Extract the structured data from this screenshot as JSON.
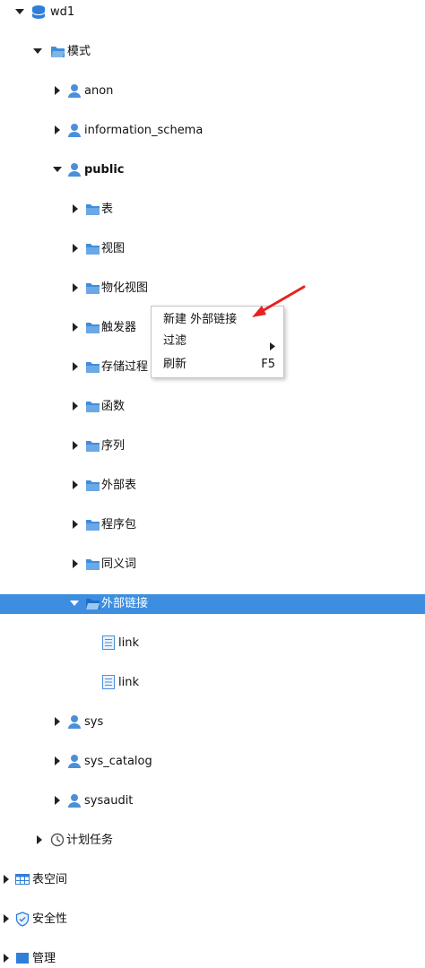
{
  "tree": {
    "db": "wd1",
    "schemas_folder": "模式",
    "schema_anon": "anon",
    "schema_information": "information_schema",
    "schema_public": "public",
    "public_children": [
      "表",
      "视图",
      "物化视图",
      "触发器",
      "存储过程",
      "函数",
      "序列",
      "外部表",
      "程序包",
      "同义词",
      "外部链接"
    ],
    "links": [
      "link",
      "link"
    ],
    "schema_sys": "sys",
    "schema_sys_catalog": "sys_catalog",
    "schema_sysaudit": "sysaudit",
    "scheduled_tasks": "计划任务",
    "tablespaces": "表空间",
    "security": "安全性",
    "cutoff": "管理"
  },
  "context_menu": {
    "new_link": "新建 外部链接",
    "filter": "过滤",
    "refresh": "刷新",
    "refresh_shortcut": "F5"
  },
  "colors": {
    "selection": "#3d8ee0",
    "folder": "#3f8ddc",
    "user": "#4a90d9",
    "annotation": "#e8211f"
  }
}
